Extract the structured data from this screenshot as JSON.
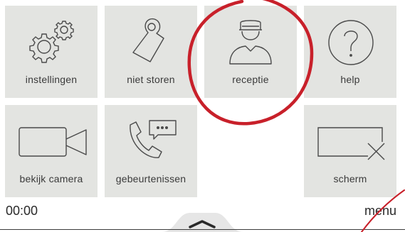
{
  "tiles": {
    "instellingen": {
      "label": "instellingen",
      "icon": "gears-icon"
    },
    "niet_storen": {
      "label": "niet storen",
      "icon": "door-hanger-icon"
    },
    "receptie": {
      "label": "receptie",
      "icon": "receptionist-icon"
    },
    "help": {
      "label": "help",
      "icon": "question-circle-icon"
    },
    "camera": {
      "label": "bekijk camera",
      "icon": "video-camera-icon"
    },
    "events": {
      "label": "gebeurtenissen",
      "icon": "phone-message-icon"
    },
    "scherm": {
      "label": "scherm",
      "icon": "screen-off-icon"
    }
  },
  "status_bar": {
    "clock": "00:00",
    "menu_label": "menu",
    "handle_icon": "chevron-up-icon"
  },
  "colors": {
    "tile_background": "#e3e4e1",
    "highlight_ring": "#c8202a",
    "icon_stroke": "#4a4a4a"
  }
}
